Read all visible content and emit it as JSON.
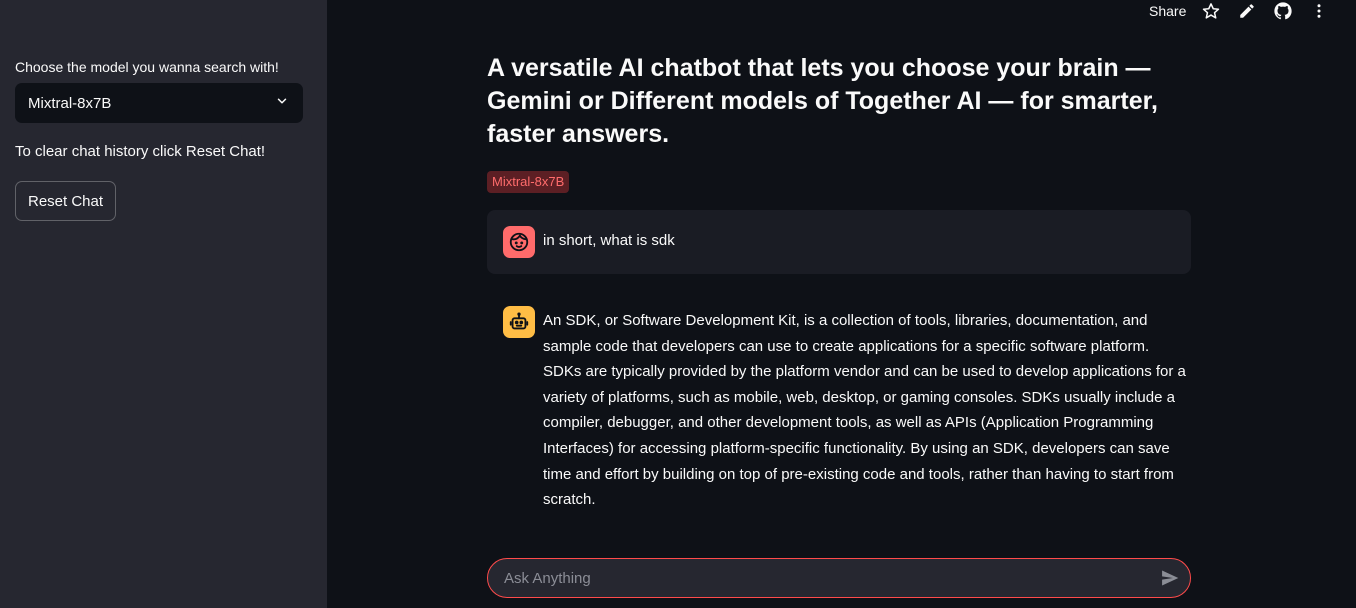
{
  "sidebar": {
    "model_label": "Choose the model you wanna search with!",
    "model_selected": "Mixtral-8x7B",
    "reset_hint": "To clear chat history click Reset Chat!",
    "reset_button": "Reset Chat"
  },
  "topbar": {
    "share_label": "Share",
    "icons": [
      "star-icon",
      "edit-icon",
      "github-icon",
      "more-icon"
    ]
  },
  "main": {
    "title": "A versatile AI chatbot that lets you choose your brain — Gemini or Different models of Together AI — for smarter, faster answers.",
    "model_badge": "Mixtral-8x7B",
    "messages": [
      {
        "role": "user",
        "avatar": "user-face-icon",
        "text": "in short, what is sdk"
      },
      {
        "role": "assistant",
        "avatar": "robot-icon",
        "text": "An SDK, or Software Development Kit, is a collection of tools, libraries, documentation, and sample code that developers can use to create applications for a specific software platform. SDKs are typically provided by the platform vendor and can be used to develop applications for a variety of platforms, such as mobile, web, desktop, or gaming consoles. SDKs usually include a compiler, debugger, and other development tools, as well as APIs (Application Programming Interfaces) for accessing platform-specific functionality. By using an SDK, developers can save time and effort by building on top of pre-existing code and tools, rather than having to start from scratch."
      }
    ],
    "input": {
      "placeholder": "Ask Anything",
      "value": ""
    }
  },
  "colors": {
    "background": "#0e1117",
    "sidebar": "#262730",
    "accent": "#ff4b4b",
    "user_avatar": "#ff6b6b",
    "bot_avatar": "#ffbd45"
  }
}
